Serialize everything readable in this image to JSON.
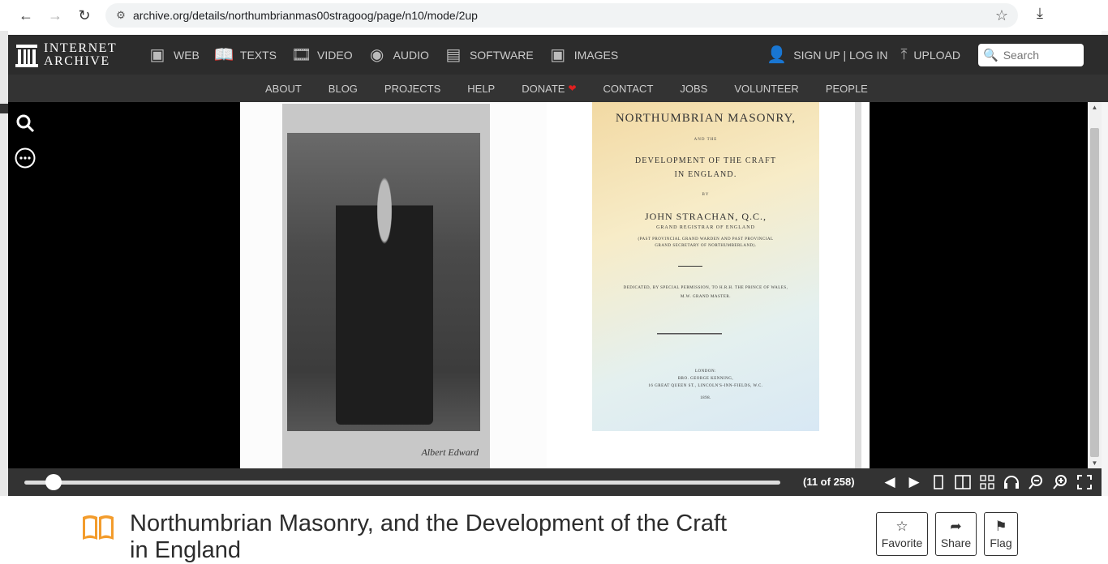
{
  "browser": {
    "url": "archive.org/details/northumbrianmas00stragoog/page/n10/mode/2up"
  },
  "ia": {
    "logo_line1": "INTERNET",
    "logo_line2": "ARCHIVE",
    "media": [
      {
        "label": "WEB",
        "icon": "web-icon"
      },
      {
        "label": "TEXTS",
        "icon": "texts-icon"
      },
      {
        "label": "VIDEO",
        "icon": "video-icon"
      },
      {
        "label": "AUDIO",
        "icon": "audio-icon"
      },
      {
        "label": "SOFTWARE",
        "icon": "software-icon"
      },
      {
        "label": "IMAGES",
        "icon": "images-icon"
      }
    ],
    "auth": "SIGN UP | LOG IN",
    "upload": "UPLOAD",
    "search_placeholder": "Search",
    "subnav": [
      "ABOUT",
      "BLOG",
      "PROJECTS",
      "HELP",
      "DONATE",
      "CONTACT",
      "JOBS",
      "VOLUNTEER",
      "PEOPLE"
    ]
  },
  "reader": {
    "page_count": "(11 of 258)",
    "progress_fraction": 0.039,
    "signature": "Albert Edward",
    "title_page": {
      "title": "NORTHUMBRIAN MASONRY,",
      "and_the": "AND THE",
      "subtitle_1": "DEVELOPMENT OF THE CRAFT",
      "subtitle_2": "IN ENGLAND.",
      "by": "BY",
      "author": "JOHN STRACHAN, Q.C.,",
      "role": "GRAND REGISTRAR OF ENGLAND",
      "past_1": "(PAST PROVINCIAL GRAND WARDEN AND PAST PROVINCIAL",
      "past_2": "GRAND SECRETARY OF NORTHUMBERLAND).",
      "dedication_1": "DEDICATED, BY SPECIAL PERMISSION, TO H.R.H. THE PRINCE OF WALES,",
      "dedication_2": "M.W. GRAND MASTER.",
      "city": "LONDON:",
      "publisher": "BRO. GEORGE KENNING,",
      "address": "16 GREAT QUEEN ST., LINCOLN'S-INN-FIELDS, W.C.",
      "year": "1898."
    }
  },
  "item": {
    "title": "Northumbrian Masonry, and the Development of the Craft in England",
    "actions": [
      {
        "label": "Favorite",
        "icon": "star-icon"
      },
      {
        "label": "Share",
        "icon": "share-icon"
      },
      {
        "label": "Flag",
        "icon": "flag-icon"
      }
    ]
  },
  "colors": {
    "nav_bg": "#2c2c2c",
    "subnav_bg": "#333333",
    "donate_heart": "#e02020",
    "texts_accent": "#f39c2c"
  }
}
